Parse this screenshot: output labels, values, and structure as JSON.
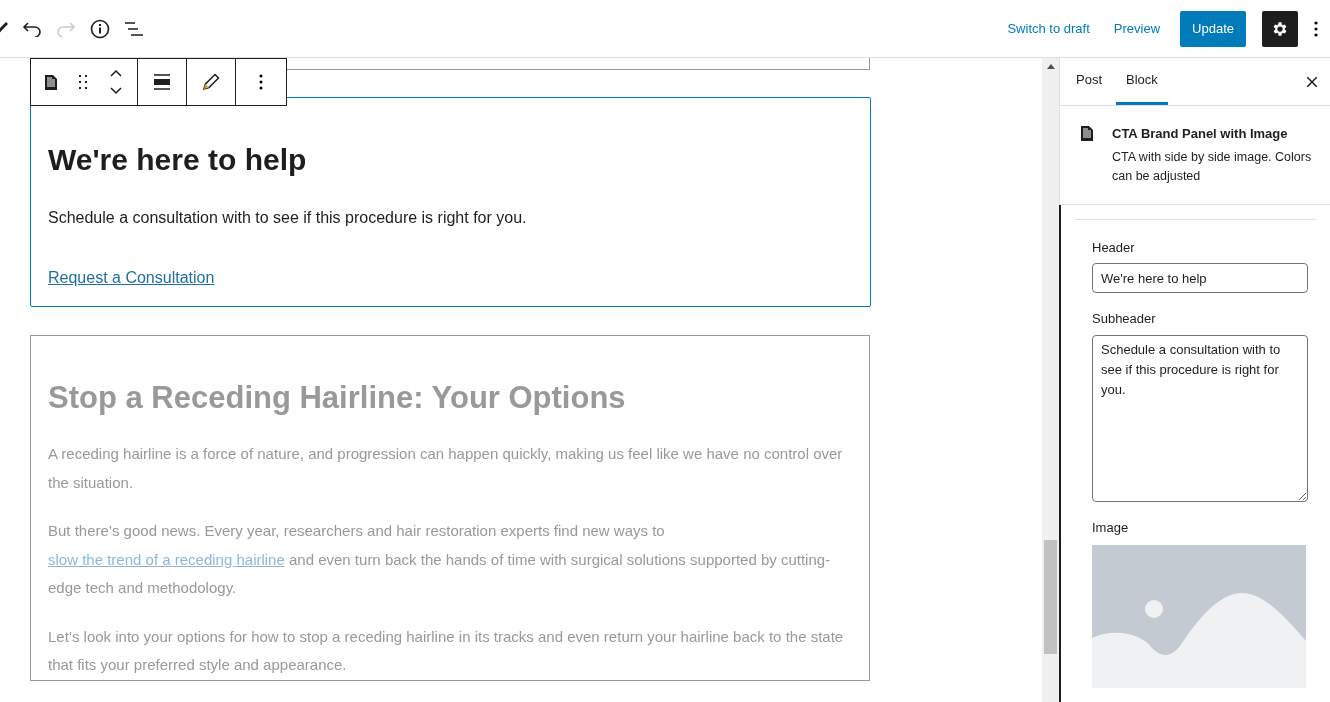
{
  "top_bar": {
    "undo": {
      "disabled": false
    },
    "redo": {
      "disabled": true
    },
    "actions": [
      {
        "kind": "link",
        "label": "Switch to draft"
      },
      {
        "kind": "link",
        "label": "Preview"
      },
      {
        "kind": "primary",
        "label": "Update"
      }
    ],
    "settings": {
      "pressed": true
    }
  },
  "selected_block": {
    "heading": "We're here to help",
    "text": "Schedule a consultation with to see if this procedure is right for you.",
    "link": "Request a Consultation"
  },
  "next_block": {
    "heading": "Stop a Receding Hairline: Your Options",
    "paragraphs": [
      [
        {
          "kind": "text",
          "text": "A receding hairline is a force of nature, and progression can happen quickly, making us feel like we have no control over the situation."
        }
      ],
      [
        {
          "kind": "text",
          "text": "But there’s good news. Every year, researchers and hair restoration experts find new ways to"
        },
        {
          "kind": "link",
          "text": " slow the trend of a receding hairline"
        },
        {
          "kind": "text",
          "text": " and even turn back the hands of time with surgical solutions supported by cutting-edge tech and methodology."
        }
      ],
      [
        {
          "kind": "text",
          "text": "Let’s look into your options for how to stop a receding hairline in its tracks and even return your hairline back to the state that fits your preferred style and appearance."
        }
      ]
    ]
  },
  "sidebar": {
    "tabs": [
      {
        "label": "Post",
        "selected": false
      },
      {
        "label": "Block",
        "selected": true
      }
    ],
    "block_title": "CTA Brand Panel with Image",
    "block_description": "CTA with side by side image. Colors can be adjusted",
    "fields": [
      {
        "kind": "input",
        "label": "Header",
        "value": "We're here to help"
      },
      {
        "kind": "textarea",
        "label": "Subheader",
        "value": "Schedule a consultation with to see if this procedure is right for you."
      },
      {
        "label": "Image"
      }
    ]
  }
}
